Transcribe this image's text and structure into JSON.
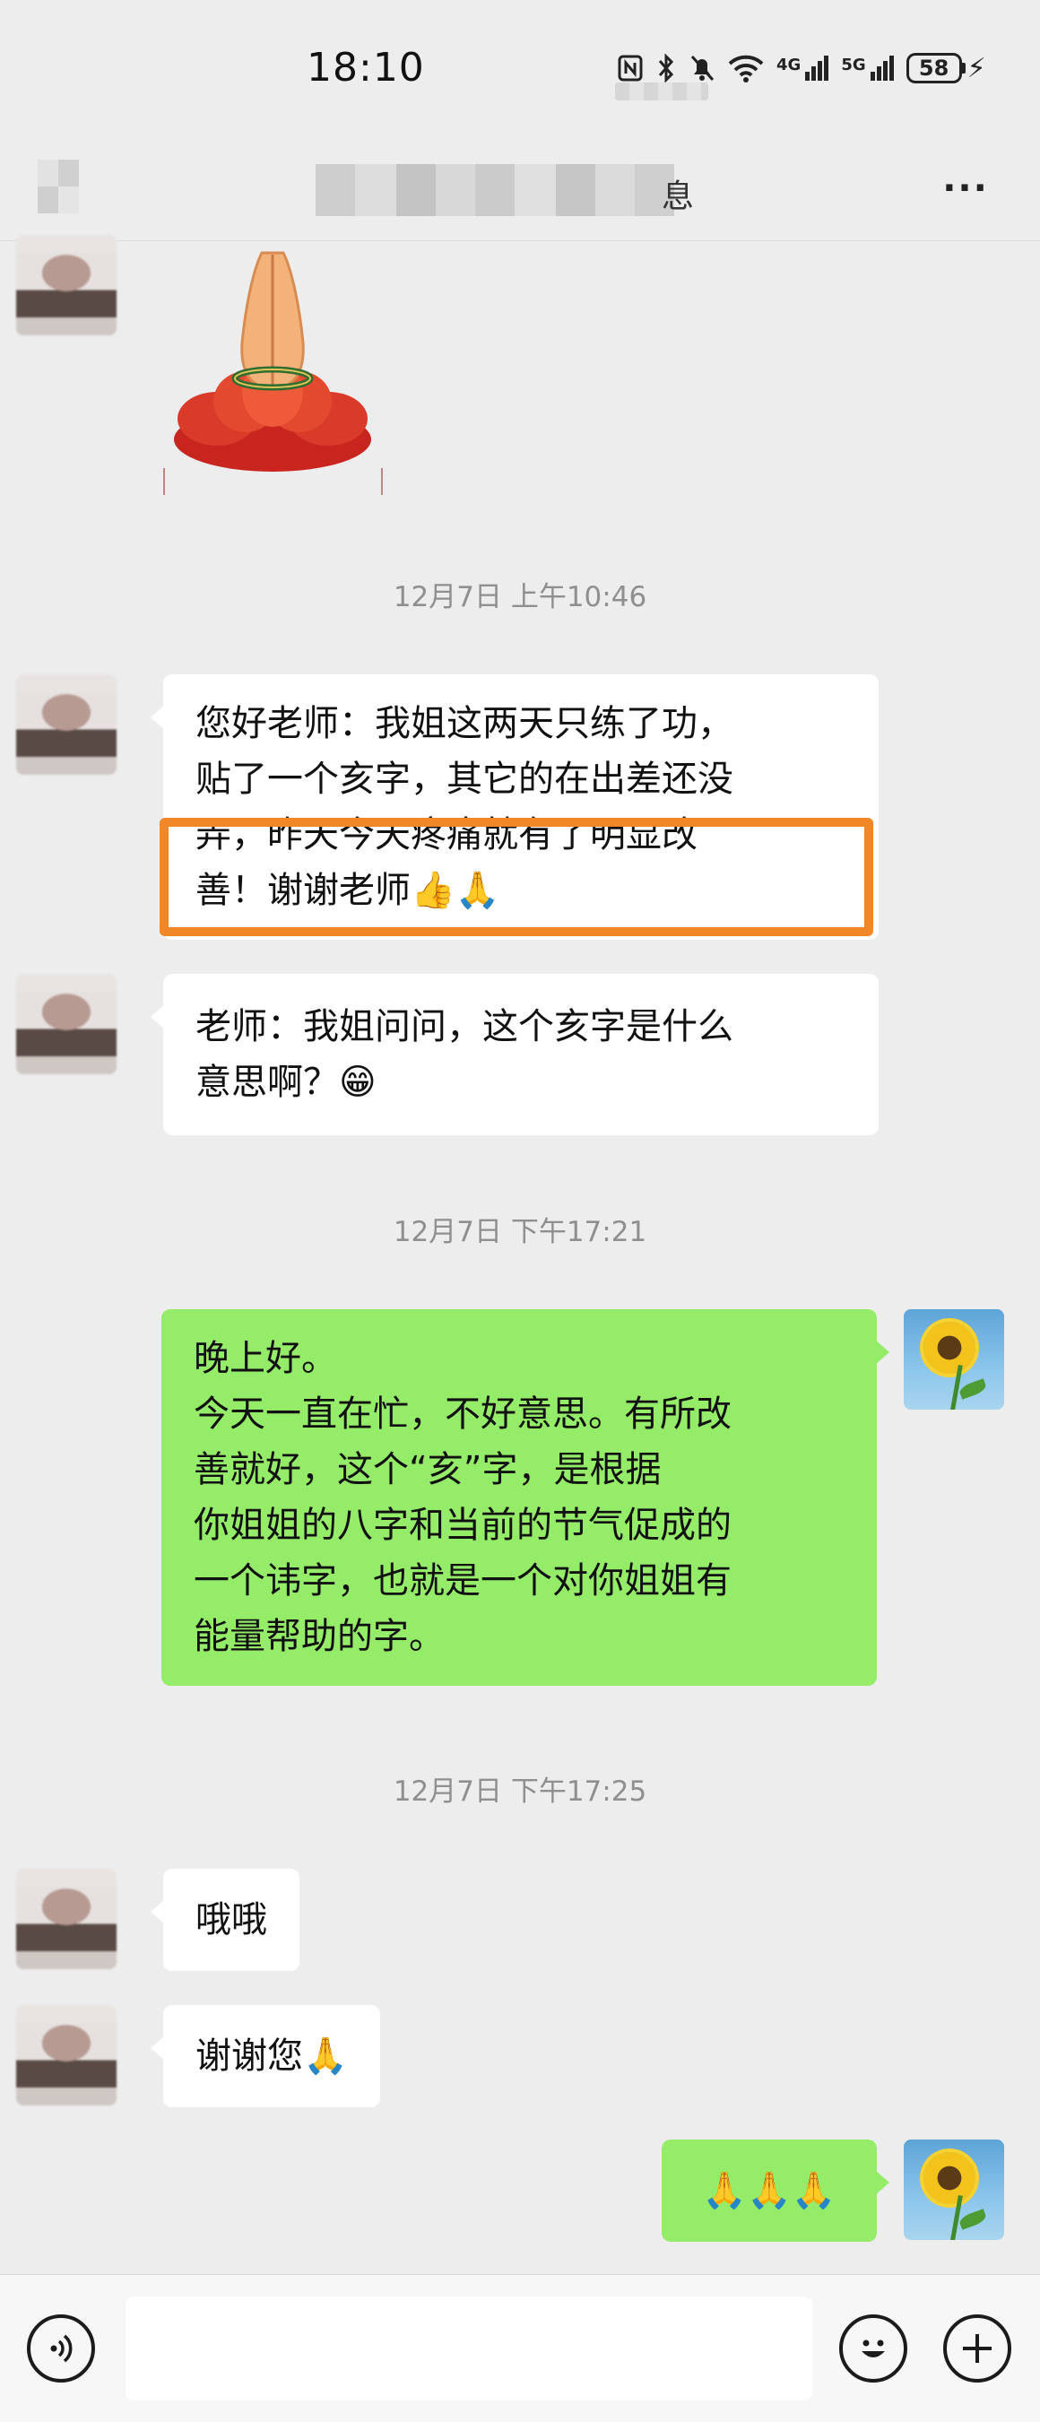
{
  "status_bar": {
    "time": "18:10",
    "battery": "58",
    "network_1": "4G",
    "network_2": "5G"
  },
  "header": {
    "title_visible_fragment": "息",
    "more_label": "···"
  },
  "messages": [
    {
      "id": "m1",
      "from": "contact",
      "kind": "sticker",
      "sticker_name": "praying-hands-on-lotus"
    },
    {
      "id": "t1",
      "kind": "timestamp",
      "text": "12月7日 上午10:46"
    },
    {
      "id": "m2",
      "from": "contact",
      "kind": "text",
      "lines": [
        "您好老师：我姐这两天只练了功，",
        "贴了一个亥字，其它的在出差还没",
        "弄，昨天今天疼痛就有了明显改",
        "善！谢谢老师👍🙏"
      ]
    },
    {
      "id": "m3",
      "from": "contact",
      "kind": "text",
      "lines": [
        "老师：我姐问问，这个亥字是什么",
        "意思啊？😁"
      ]
    },
    {
      "id": "t2",
      "kind": "timestamp",
      "text": "12月7日 下午17:21"
    },
    {
      "id": "m4",
      "from": "me",
      "kind": "text",
      "lines": [
        "晚上好。",
        "今天一直在忙，不好意思。有所改",
        "善就好，这个“亥”字，是根据",
        "你姐姐的八字和当前的节气促成的",
        "一个讳字，也就是一个对你姐姐有",
        "能量帮助的字。"
      ]
    },
    {
      "id": "t3",
      "kind": "timestamp",
      "text": "12月7日 下午17:25"
    },
    {
      "id": "m5",
      "from": "contact",
      "kind": "text",
      "lines": [
        "哦哦"
      ]
    },
    {
      "id": "m6",
      "from": "contact",
      "kind": "text",
      "lines": [
        "谢谢您🙏"
      ]
    },
    {
      "id": "m7",
      "from": "me",
      "kind": "text",
      "lines": [
        "🙏🙏🙏"
      ]
    }
  ],
  "annotation": {
    "highlight_color": "#f28728"
  },
  "colors": {
    "background": "#ededed",
    "incoming_bubble": "#ffffff",
    "outgoing_bubble": "#95ec69",
    "timestamp_text": "#8f8f8f"
  },
  "input_bar": {
    "voice_icon": "voice-icon",
    "emoji_icon": "emoji-icon",
    "plus_icon": "plus-icon",
    "input_value": ""
  }
}
